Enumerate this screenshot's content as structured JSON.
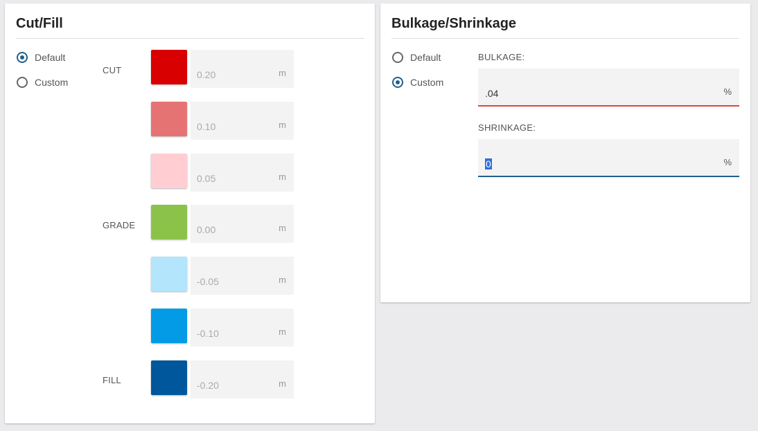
{
  "cutfill": {
    "title": "Cut/Fill",
    "options": {
      "default_label": "Default",
      "custom_label": "Custom",
      "selected": "Default"
    },
    "labels": {
      "cut": "CUT",
      "grade": "GRADE",
      "fill": "FILL"
    },
    "rows": [
      {
        "color": "#d80000",
        "value": "0.20",
        "unit": "m"
      },
      {
        "color": "#e57373",
        "value": "0.10",
        "unit": "m"
      },
      {
        "color": "#ffcdd2",
        "value": "0.05",
        "unit": "m"
      },
      {
        "color": "#8bc34a",
        "value": "0.00",
        "unit": "m"
      },
      {
        "color": "#b3e5fc",
        "value": "-0.05",
        "unit": "m"
      },
      {
        "color": "#039be5",
        "value": "-0.10",
        "unit": "m"
      },
      {
        "color": "#01579b",
        "value": "-0.20",
        "unit": "m"
      }
    ]
  },
  "bulk": {
    "title": "Bulkage/Shrinkage",
    "options": {
      "default_label": "Default",
      "custom_label": "Custom",
      "selected": "Custom"
    },
    "bulkage": {
      "caption": "BULKAGE:",
      "value": ".04",
      "unit": "%",
      "accent": "#d9473a"
    },
    "shrinkage": {
      "caption": "SHRINKAGE:",
      "value": "0",
      "unit": "%",
      "accent": "#1f5f8b"
    }
  }
}
